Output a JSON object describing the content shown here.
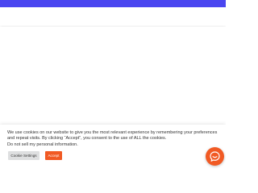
{
  "colors": {
    "top_bar": "#4a46f0",
    "accent": "#f15a24",
    "settings_button_bg": "#dedfe0"
  },
  "cookie_banner": {
    "message": "We use cookies on our website to give you the most relevant experience by remembering your preferences and repeat visits. By clicking “Accept”, you consent to the use of ALL the cookies.",
    "do_not_sell_label": "Do not sell my personal information.",
    "settings_button_label": "Cookie Settings",
    "accept_button_label": "Accept"
  },
  "chat_launcher": {
    "icon": "chat-bubble-icon"
  }
}
